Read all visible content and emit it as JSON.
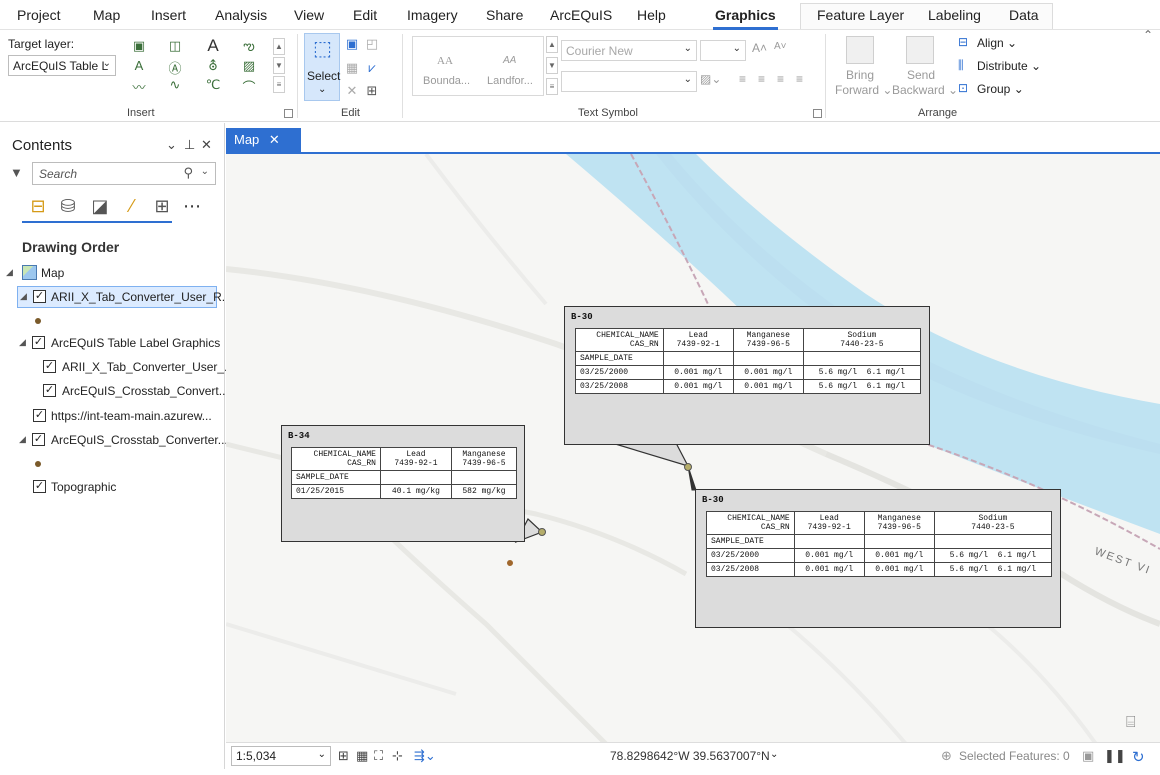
{
  "ribbon_tabs": [
    "Project",
    "Map",
    "Insert",
    "Analysis",
    "View",
    "Edit",
    "Imagery",
    "Share",
    "ArcEQuIS",
    "Help",
    "Graphics",
    "Feature Layer",
    "Labeling",
    "Data"
  ],
  "active_tab": "Graphics",
  "accent_color": "#2e6fd1",
  "insert_group": {
    "target_layer_label": "Target layer:",
    "target_layer_value": "ArcEQuIS Table L",
    "group_label": "Insert"
  },
  "edit_group": {
    "select_label": "Select",
    "group_label": "Edit"
  },
  "text_symbol_group": {
    "gallery_items": [
      "Bounda...",
      "Landfor..."
    ],
    "font_name": "Courier New",
    "group_label": "Text Symbol"
  },
  "arrange_group": {
    "bring_forward": "Bring Forward",
    "send_backward": "Send Backward",
    "align": "Align",
    "distribute": "Distribute",
    "group": "Group",
    "group_label": "Arrange"
  },
  "contents": {
    "title": "Contents",
    "search_placeholder": "Search",
    "section_title": "Drawing Order",
    "map_label": "Map",
    "layers": [
      "ARII_X_Tab_Converter_User_R...",
      "ArcEQuIS Table Label Graphics",
      "ARII_X_Tab_Converter_User_...",
      "ArcEQuIS_Crosstab_Convert...",
      "https://int-team-main.azurew...",
      "ArcEQuIS_Crosstab_Converter...",
      "Topographic"
    ]
  },
  "map_tab_label": "Map",
  "map": {
    "road_label": "WEST VI"
  },
  "callouts": {
    "b34": {
      "title": "B-34",
      "header": [
        "CHEMICAL_NAME",
        "Lead",
        "Manganese"
      ],
      "subheader": [
        "CAS_RN",
        "7439-92-1",
        "7439-96-5"
      ],
      "sample_date_label": "SAMPLE_DATE",
      "rows": [
        [
          "01/25/2015",
          "40.1 mg/kg",
          "582 mg/kg"
        ]
      ]
    },
    "b30": {
      "title": "B-30",
      "header": [
        "CHEMICAL_NAME",
        "Lead",
        "Manganese",
        "Sodium"
      ],
      "subheader": [
        "CAS_RN",
        "7439-92-1",
        "7439-96-5",
        "7440-23-5"
      ],
      "sample_date_label": "SAMPLE_DATE",
      "rows": [
        [
          "03/25/2000",
          "0.001 mg/l",
          "0.001 mg/l",
          "5.6 mg/l  6.1 mg/l"
        ],
        [
          "03/25/2008",
          "0.001 mg/l",
          "0.001 mg/l",
          "5.6 mg/l  6.1 mg/l"
        ]
      ]
    }
  },
  "status": {
    "scale": "1:5,034",
    "coordinates": "78.8298642°W 39.5637007°N",
    "selected_features": "Selected Features: 0"
  }
}
